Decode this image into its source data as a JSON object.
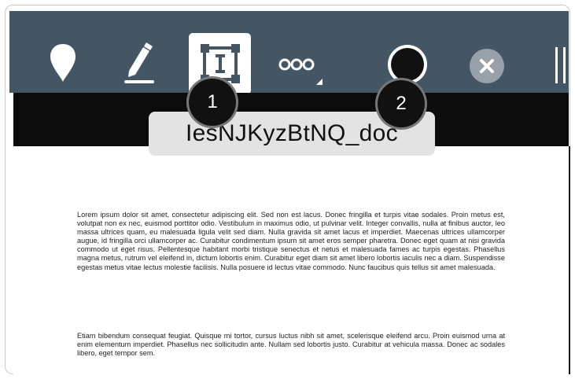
{
  "toolbar": {
    "tools": [
      {
        "name": "pin-icon"
      },
      {
        "name": "pen-icon"
      },
      {
        "name": "text-box-icon",
        "selected": true
      },
      {
        "name": "more-icon"
      },
      {
        "name": "color-swatch",
        "color": "#111111"
      },
      {
        "name": "close-icon"
      },
      {
        "name": "drag-handle-icon"
      }
    ],
    "bar_color": "#445564"
  },
  "document": {
    "title": "IesNJKyzBtNQ_doc",
    "paragraphs": [
      "Lorem ipsum dolor sit amet, consectetur adipiscing elit. Sed non est lacus. Donec fringilla et turpis vitae sodales. Proin metus est, volutpat non ex nec, euismod porttitor odio. Vestibulum in maximus odio, ut pulvinar velit. Integer convallis, nulla at finibus auctor, leo massa ultrices quam, eu malesuada ligula velit sed diam. Nulla gravida sit amet lacus et imperdiet. Maecenas ultrices ullamcorper augue, id fringilla orci ullamcorper ac. Curabitur condimentum ipsum sit amet eros semper pharetra. Donec eget quam at nisi gravida commodo ut eget risus. Pellentesque habitant morbi tristique senectus et netus et malesuada fames ac turpis egestas. Phasellus magna metus, rutrum vel eleifend in, dictum lobortis enim. Curabitur eget diam sit amet libero lobortis iaculis nec a diam. Suspendisse egestas metus vitae lectus molestie facilisis. Nulla posuere id lectus vitae commodo. Nunc faucibus quis tellus sit amet malesuada.",
      "Etiam bibendum consequat feugiat. Quisque mi tortor, cursus luctus nibh sit amet, scelerisque eleifend arcu. Proin euismod urna at enim elementum imperdiet. Phasellus nec sollicitudin ante. Nullam sed lobortis justo. Curabitur at vehicula massa. Donec ac sodales libero, eget tempor sem."
    ]
  },
  "callouts": [
    "1",
    "2"
  ]
}
